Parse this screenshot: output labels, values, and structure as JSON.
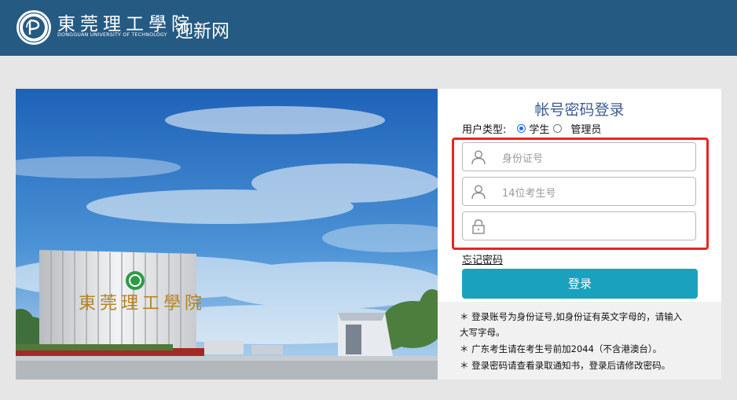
{
  "header": {
    "university_name_cn": "東莞理工學院",
    "university_name_en": "DONGGUAN UNIVERSITY OF TECHNOLOGY",
    "site_title": "迎新网",
    "bg_color": "#255a83"
  },
  "photo": {
    "building_sign": "東莞理工學院"
  },
  "login": {
    "title": "帐号密码登录",
    "user_type_label": "用户类型:",
    "user_types": [
      {
        "label": "学生",
        "selected": true
      },
      {
        "label": "管理员",
        "selected": false
      }
    ],
    "id_field": {
      "placeholder": "身份证号",
      "value": "",
      "icon": "user-icon"
    },
    "exam_field": {
      "placeholder": "14位考生号",
      "value": "",
      "icon": "user-icon"
    },
    "password_field": {
      "placeholder": "",
      "value": "",
      "icon": "lock-icon"
    },
    "forgot_password": "忘记密码",
    "login_button": "登录",
    "button_color": "#1aa1bd",
    "highlight_color": "#e8251e"
  },
  "notes": [
    "＊ 登录账号为身份证号,如身份证有英文字母的，请输入",
    "大写字母。",
    "＊ 广东考生请在考生号前加2044（不含港澳台）。",
    "＊ 登录密码请查看录取通知书，登录后请修改密码。"
  ]
}
